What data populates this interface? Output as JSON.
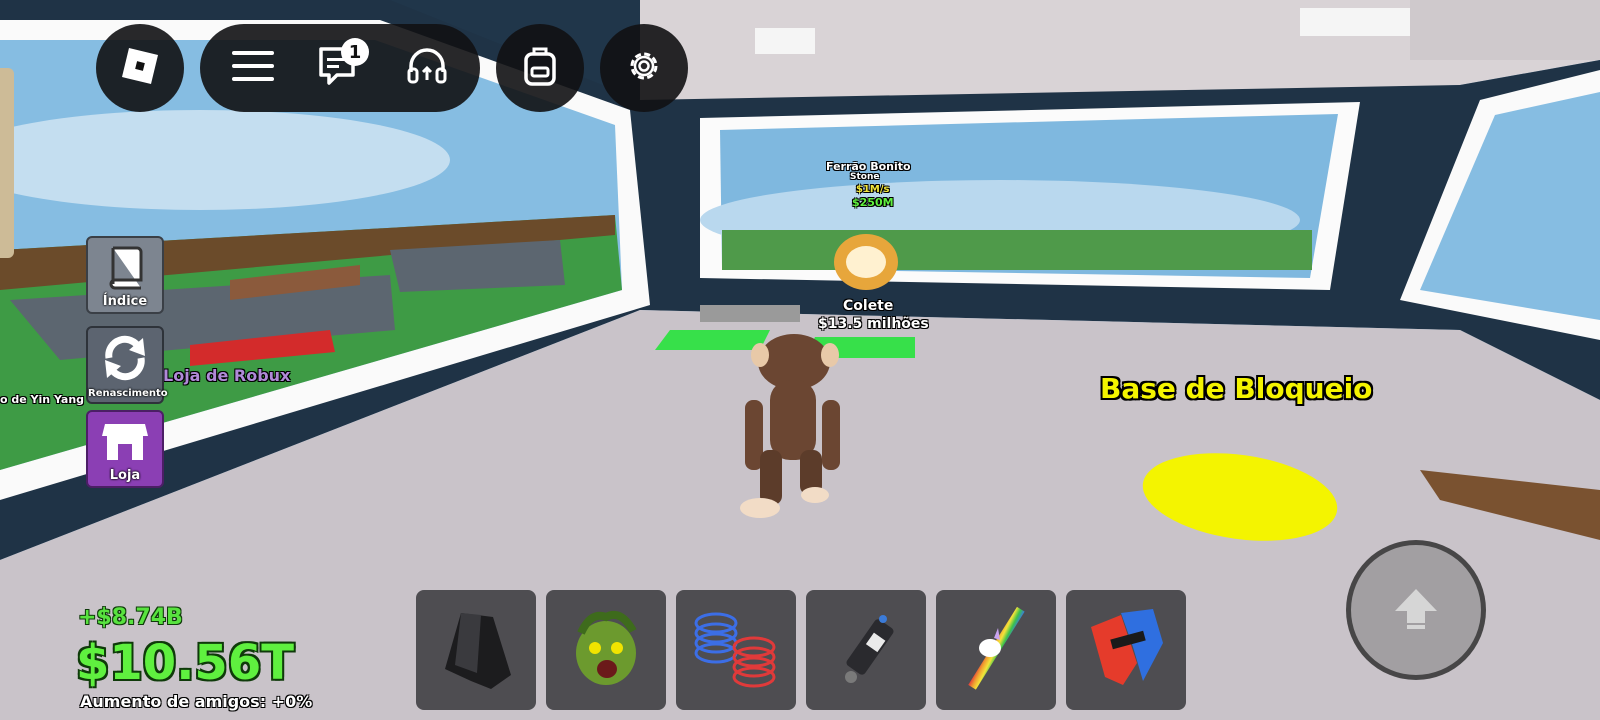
{
  "top_bar": {
    "roblox_icon": "roblox-logo-icon",
    "menu_icon": "hamburger-menu-icon",
    "chat_icon": "chat-icon",
    "chat_badge": "1",
    "voice_icon": "headphones-icon",
    "backpack_icon": "backpack-icon",
    "settings_icon": "gear-icon"
  },
  "side_menu": {
    "items": [
      {
        "label": "Índice",
        "icon": "book-icon",
        "color": "#7d8590"
      },
      {
        "label": "Renascimento",
        "icon": "refresh-icon",
        "color": "#5c6470"
      },
      {
        "label": "Loja",
        "icon": "shop-icon",
        "color": "#8b3fb4"
      }
    ]
  },
  "world": {
    "sign_name": "Ferrão Bonito",
    "sign_sub": "Stone",
    "sign_rate": "$1M/s",
    "sign_price": "$250M",
    "item_name": "Colete",
    "item_price": "$13.5 milhões",
    "robux_shop": "Loja de Robux",
    "far_left_name": "o de Yin Yang",
    "lock_base": "Base de Bloqueio"
  },
  "hotbar": {
    "slots": [
      {
        "name": "black-cloak-icon"
      },
      {
        "name": "medusa-head-icon"
      },
      {
        "name": "spring-coils-icon"
      },
      {
        "name": "grapple-gun-icon"
      },
      {
        "name": "rainbow-sword-icon"
      },
      {
        "name": "red-blue-tool-icon"
      }
    ]
  },
  "stats": {
    "money_delta": "+$8.74B",
    "money": "$10.56T",
    "friend_boost": "Aumento de amigos: +0%"
  },
  "controls": {
    "jump_icon": "jump-arrow-icon"
  },
  "colors": {
    "money_green": "#5ff03f",
    "lock_yellow": "#f4f400",
    "floor": "#c8c2c8",
    "wall": "#1f3346"
  }
}
